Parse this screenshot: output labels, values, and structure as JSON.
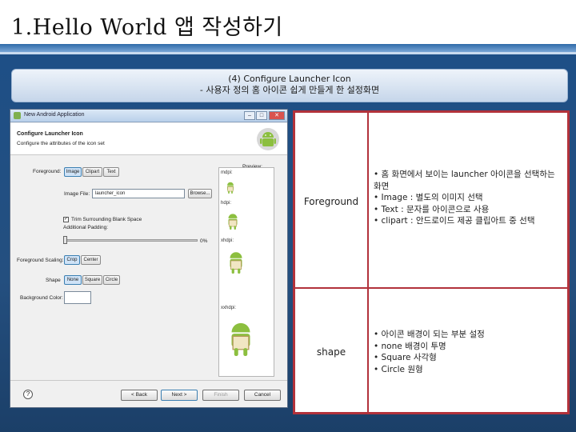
{
  "slide": {
    "title": "1.Hello World 앱 작성하기",
    "caption_line1": "(4) Configure Launcher Icon",
    "caption_line2": "-  사용자 정의 홈 아이콘 쉽게 만들게 한 설정화면"
  },
  "dialog": {
    "window_title": "New Android Application",
    "header_title": "Configure Launcher Icon",
    "header_subtitle": "Configure the attributes of the icon set",
    "foreground_label": "Foreground:",
    "foreground_options": [
      "Image",
      "Clipart",
      "Text"
    ],
    "foreground_selected": "Image",
    "image_file_label": "Image File:",
    "image_file_value": "launcher_icon",
    "browse_label": "Browse...",
    "trim_label": "Trim Surrounding Blank Space",
    "trim_checked": true,
    "padding_label": "Additional Padding:",
    "padding_value": "0%",
    "padding_fraction": 0.0,
    "scaling_label": "Foreground Scaling:",
    "scaling_options": [
      "Crop",
      "Center"
    ],
    "scaling_selected": "Crop",
    "shape_label": "Shape",
    "shape_options": [
      "None",
      "Square",
      "Circle"
    ],
    "shape_selected": "None",
    "bg_color_label": "Background Color:",
    "preview_label": "Preview:",
    "densities": [
      "mdpi:",
      "hdpi:",
      "xhdpi:",
      "xxhdpi:"
    ],
    "buttons": {
      "help": "?",
      "back": "< Back",
      "next": "Next >",
      "finish": "Finish",
      "cancel": "Cancel"
    }
  },
  "table": {
    "rows": [
      {
        "name": "Foreground",
        "bullets": [
          "홈 화면에서 보이는 launcher 아이콘을 선택하는 화면",
          "Image : 별도의 이미지 선택",
          "Text : 문자를 아이콘으로 사용",
          "clipart : 안드로이드 제공 클립아트 중 선택"
        ]
      },
      {
        "name": "shape",
        "bullets": [
          "아이콘 배경이 되는 부분 설정",
          "none 배경이 투명",
          "Square 사각형",
          "Circle 원형"
        ]
      }
    ]
  },
  "colors": {
    "slide_band": "#2f6aa8",
    "table_border": "#b2323b",
    "android_green": "#8cbf3f"
  }
}
